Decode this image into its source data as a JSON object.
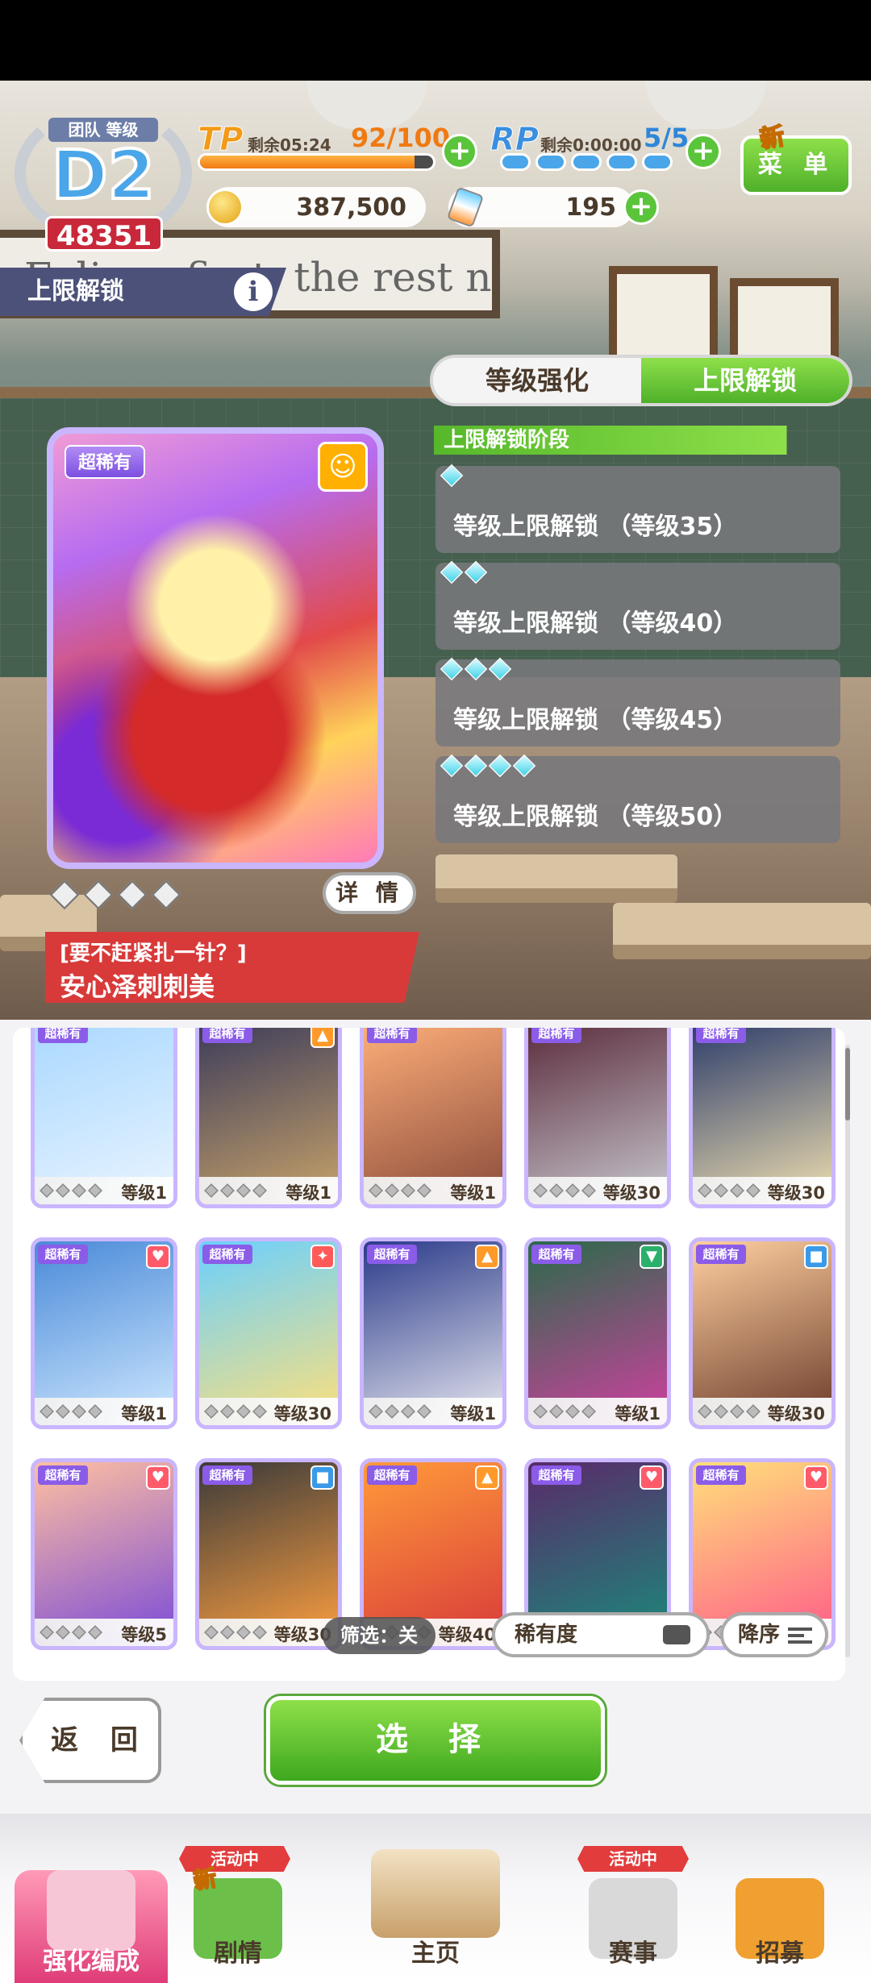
{
  "hud": {
    "team_label": "团队 等级",
    "team_grade": "D2",
    "team_score": "48351",
    "tp": {
      "label": "TP",
      "remaining": "剩余05:24",
      "value": "92/100",
      "fill": 0.92
    },
    "rp": {
      "label": "RP",
      "remaining": "剩余0:00:00",
      "value": "5/5",
      "pips": 5
    },
    "menu_label": "菜 单",
    "menu_new": "新",
    "coins": "387,500",
    "carrots": "195",
    "plus": "+"
  },
  "section": {
    "title": "上限解锁",
    "info": "i"
  },
  "background": {
    "sign_text": "Eclipse first, the rest nowhere."
  },
  "tabs": [
    {
      "label": "等级强化",
      "active": false
    },
    {
      "label": "上限解锁",
      "active": true
    }
  ],
  "unlock": {
    "heading": "上限解锁阶段",
    "stages": [
      {
        "gems": 1,
        "text": "等级上限解锁 （等级35）"
      },
      {
        "gems": 2,
        "text": "等级上限解锁 （等级40）"
      },
      {
        "gems": 3,
        "text": "等级上限解锁 （等级45）"
      },
      {
        "gems": 4,
        "text": "等级上限解锁 （等级50）"
      }
    ]
  },
  "selected_card": {
    "rarity": "超稀有",
    "type_icon": "smile-icon",
    "detail_label": "详 情",
    "subtitle": "[要不赶紧扎一针？]",
    "name": "安心泽刺刺美",
    "limit_break": 0
  },
  "card_grid": [
    {
      "rarity": "超稀有",
      "icon": "",
      "level": "等级1"
    },
    {
      "rarity": "超稀有",
      "icon": "power-icon",
      "level": "等级1"
    },
    {
      "rarity": "超稀有",
      "icon": "",
      "level": "等级1"
    },
    {
      "rarity": "超稀有",
      "icon": "",
      "level": "等级30"
    },
    {
      "rarity": "超稀有",
      "icon": "",
      "level": "等级30"
    },
    {
      "rarity": "超稀有",
      "icon": "heart-icon",
      "level": "等级1"
    },
    {
      "rarity": "超稀有",
      "icon": "fire-icon",
      "level": "等级30"
    },
    {
      "rarity": "超稀有",
      "icon": "power-icon",
      "level": "等级1"
    },
    {
      "rarity": "超稀有",
      "icon": "hat-icon",
      "level": "等级1"
    },
    {
      "rarity": "超稀有",
      "icon": "stamina-icon",
      "level": "等级30"
    },
    {
      "rarity": "超稀有",
      "icon": "heart-icon",
      "level": "等级5"
    },
    {
      "rarity": "超稀有",
      "icon": "stamina-icon",
      "level": "等级30"
    },
    {
      "rarity": "超稀有",
      "icon": "power-icon",
      "level": "等级40"
    },
    {
      "rarity": "超稀有",
      "icon": "heart-icon",
      "level": ""
    },
    {
      "rarity": "超稀有",
      "icon": "heart-icon",
      "level": ""
    }
  ],
  "filter": {
    "label": "筛选：关",
    "sort_value": "稀有度",
    "order_label": "降序"
  },
  "actions": {
    "back": "返 回",
    "select": "选 择"
  },
  "nav": {
    "items": [
      {
        "label": "强化编成",
        "active": true
      },
      {
        "label": "剧情",
        "active": false
      },
      {
        "label": "主页",
        "active": false
      },
      {
        "label": "赛事",
        "active": false
      },
      {
        "label": "招募",
        "active": false
      }
    ],
    "event_badge": "活动中",
    "new_badge": "新"
  },
  "colors": {
    "accent_green": "#5ac43a",
    "tp_orange": "#f07a12",
    "rp_blue": "#2f86d8",
    "rarity_purple": "#8a5ce8",
    "ribbon_red": "#d83a3a"
  }
}
